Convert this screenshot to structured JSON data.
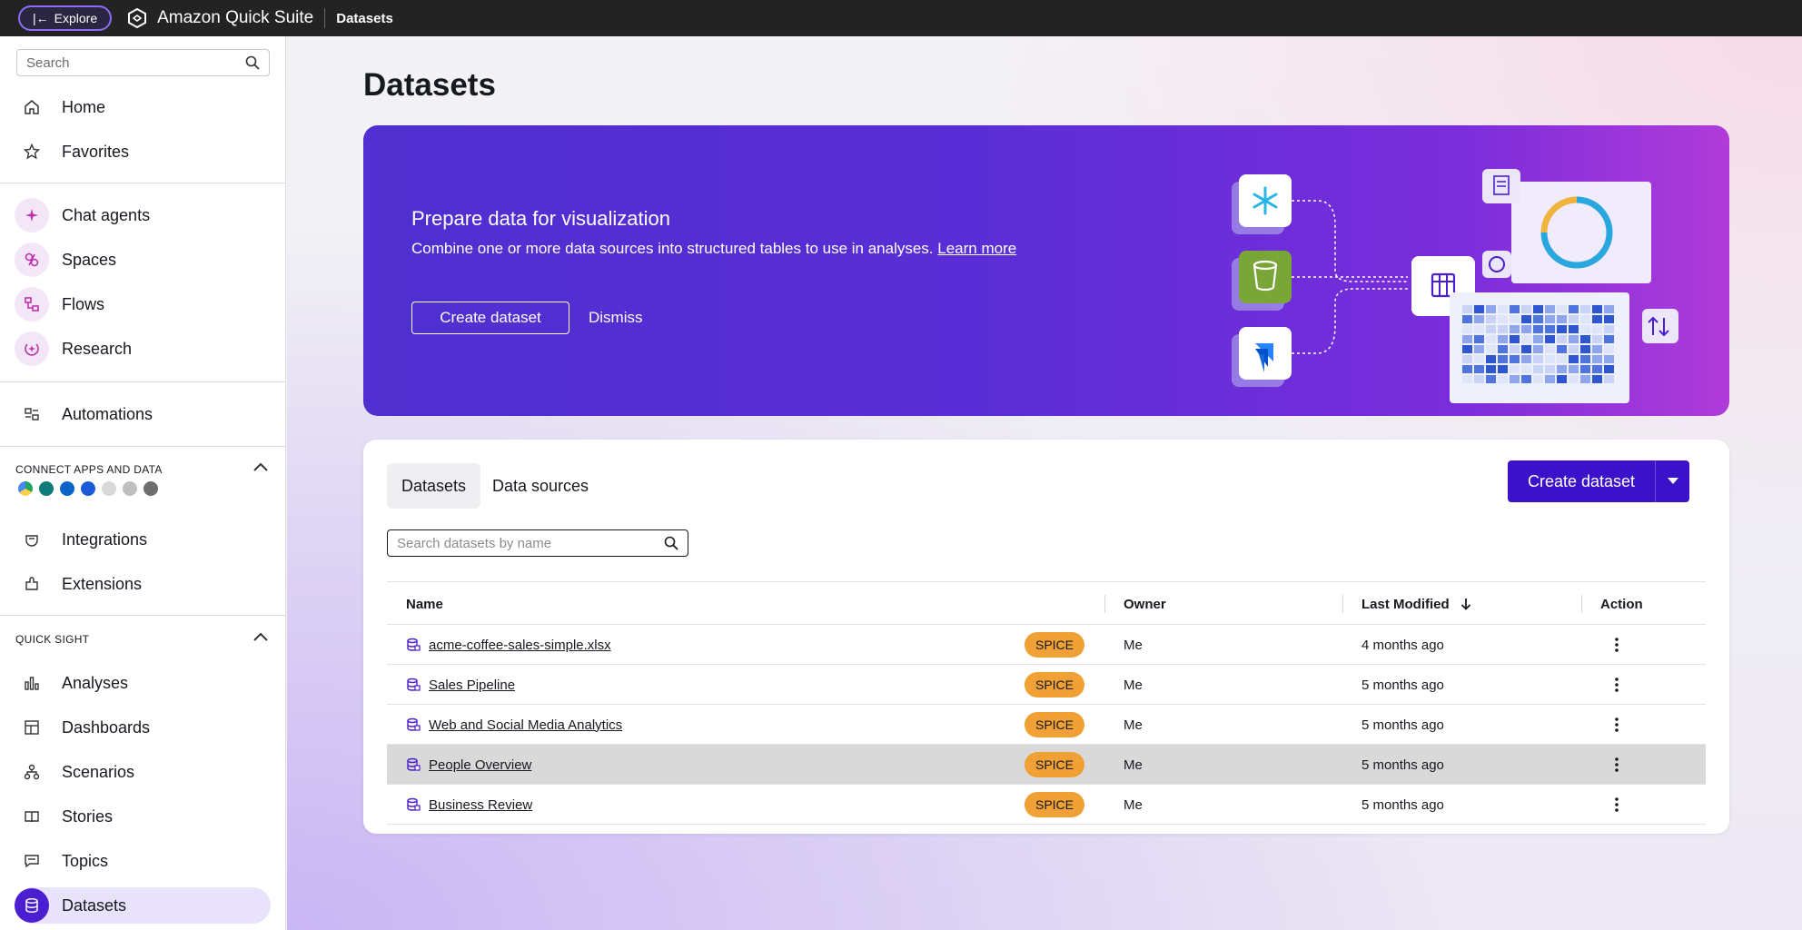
{
  "topbar": {
    "explore_label": "Explore",
    "app_name": "Amazon Quick Suite",
    "breadcrumb": "Datasets"
  },
  "sidebar": {
    "search_placeholder": "Search",
    "group1": [
      {
        "label": "Home",
        "icon": "home-icon"
      },
      {
        "label": "Favorites",
        "icon": "star-icon"
      }
    ],
    "group2": [
      {
        "label": "Chat agents",
        "icon": "sparkle-icon"
      },
      {
        "label": "Spaces",
        "icon": "spaces-icon"
      },
      {
        "label": "Flows",
        "icon": "flows-icon"
      },
      {
        "label": "Research",
        "icon": "research-icon"
      }
    ],
    "automations": {
      "label": "Automations",
      "icon": "automations-icon"
    },
    "connect_title": "CONNECT APPS AND DATA",
    "connect_group": [
      {
        "label": "Integrations",
        "icon": "integrations-icon"
      },
      {
        "label": "Extensions",
        "icon": "extensions-icon"
      }
    ],
    "quicksight_title": "QUICK SIGHT",
    "quicksight_group": [
      {
        "label": "Analyses",
        "icon": "analyses-icon"
      },
      {
        "label": "Dashboards",
        "icon": "dashboards-icon"
      },
      {
        "label": "Scenarios",
        "icon": "scenarios-icon"
      },
      {
        "label": "Stories",
        "icon": "stories-icon"
      },
      {
        "label": "Topics",
        "icon": "topics-icon"
      },
      {
        "label": "Datasets",
        "icon": "datasets-icon",
        "active": true
      }
    ]
  },
  "page": {
    "title": "Datasets"
  },
  "banner": {
    "heading": "Prepare data for visualization",
    "body": "Combine one or more data sources into structured tables to use in analyses. ",
    "link": "Learn more",
    "primary_button": "Create dataset",
    "dismiss": "Dismiss"
  },
  "card": {
    "tabs": [
      "Datasets",
      "Data sources"
    ],
    "create_button": "Create dataset",
    "search_placeholder": "Search datasets by name",
    "columns": {
      "name": "Name",
      "owner": "Owner",
      "last_modified": "Last Modified",
      "action": "Action"
    },
    "rows": [
      {
        "name": "acme-coffee-sales-simple.xlsx",
        "badge": "SPICE",
        "owner": "Me",
        "modified": "4 months ago"
      },
      {
        "name": "Sales Pipeline",
        "badge": "SPICE",
        "owner": "Me",
        "modified": "5 months ago"
      },
      {
        "name": "Web and Social Media Analytics",
        "badge": "SPICE",
        "owner": "Me",
        "modified": "5 months ago"
      },
      {
        "name": "People Overview",
        "badge": "SPICE",
        "owner": "Me",
        "modified": "5 months ago",
        "highlighted": true
      },
      {
        "name": "Business Review",
        "badge": "SPICE",
        "owner": "Me",
        "modified": "5 months ago"
      }
    ]
  },
  "colors": {
    "accent": "#3b12c9",
    "badge": "#f0a035",
    "banner_start": "#4f2fcf",
    "banner_end": "#b03bd9"
  }
}
